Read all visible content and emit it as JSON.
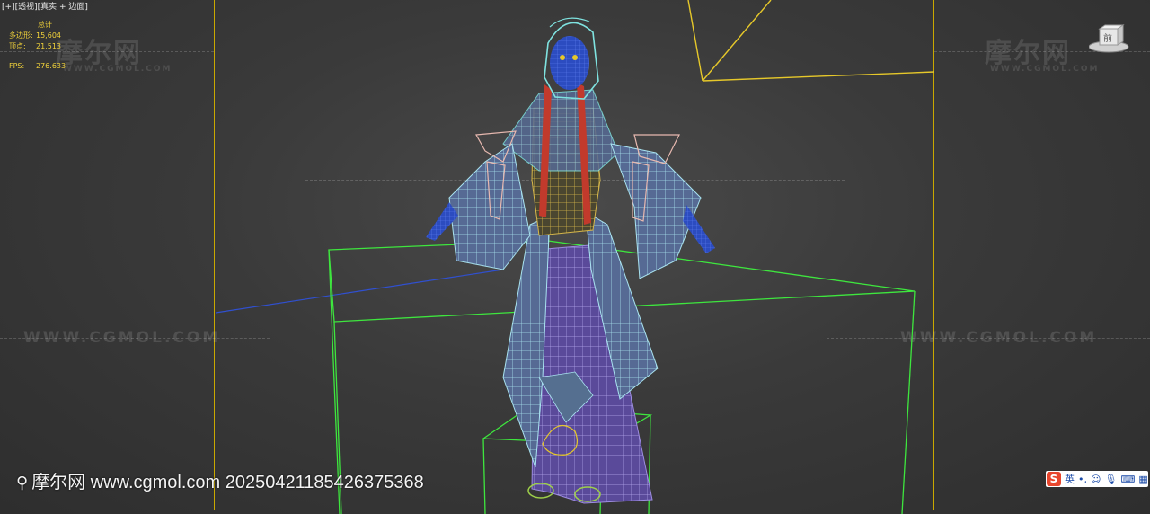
{
  "viewport": {
    "label": "[+][透视][真实 + 边面]",
    "stats": {
      "header": "总计",
      "polys_label": "多边形:",
      "polys_value": "15,604",
      "verts_label": "顶点:",
      "verts_value": "21,513",
      "fps_label": "FPS:",
      "fps_value": "276.633"
    }
  },
  "watermarks": {
    "logo_text": "摩尔网",
    "logo_sub": "WWW.CGMOL.COM",
    "url_text": "WWW.CGMOL.COM",
    "bottom_text": "摩尔网 www.cgmol.com 20250421185426375368"
  },
  "viewcube": {
    "face_label": "前"
  },
  "ime": {
    "logo": "S",
    "mode": "英",
    "icons": [
      "punctuation-icon",
      "emoji-icon",
      "microphone-icon",
      "keyboard-icon",
      "grid-icon"
    ]
  },
  "colors": {
    "safe_frame": "#c9a800",
    "bounding_box": "#3ee63e",
    "wire_cyan": "#7fe3e0",
    "wire_purple": "#7a63c8",
    "hair_red": "#c23a2c",
    "lace_pink": "#e8b9b0",
    "body_blue": "#3356c8"
  }
}
